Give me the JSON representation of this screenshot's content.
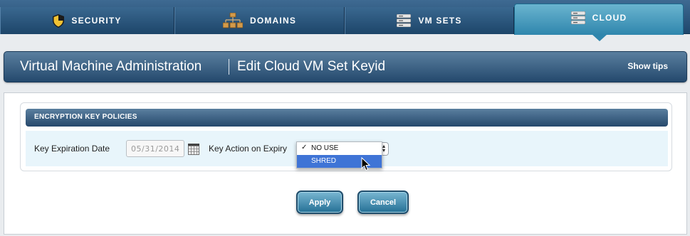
{
  "nav": {
    "tabs": [
      {
        "label": "SECURITY",
        "icon": "shield-icon"
      },
      {
        "label": "DOMAINS",
        "icon": "network-icon"
      },
      {
        "label": "VM SETS",
        "icon": "server-stack-icon"
      },
      {
        "label": "CLOUD",
        "icon": "server-stack-icon",
        "active": true
      }
    ]
  },
  "header": {
    "title": "Virtual Machine Administration",
    "subtitle": "Edit Cloud VM Set Keyid",
    "tips_label": "Show tips"
  },
  "section": {
    "title": "ENCRYPTION KEY POLICIES",
    "expiry_label": "Key Expiration Date",
    "expiry_value": "05/31/2014",
    "action_label": "Key Action on Expiry",
    "action_options": [
      "NO USE",
      "SHRED"
    ],
    "action_checked": "NO USE",
    "action_highlighted": "SHRED"
  },
  "buttons": {
    "apply": "Apply",
    "cancel": "Cancel"
  },
  "colors": {
    "nav_blue": "#24496d",
    "active_tab": "#2f86ad",
    "highlight": "#3f74d6",
    "section_bg": "#e8f5fb"
  }
}
